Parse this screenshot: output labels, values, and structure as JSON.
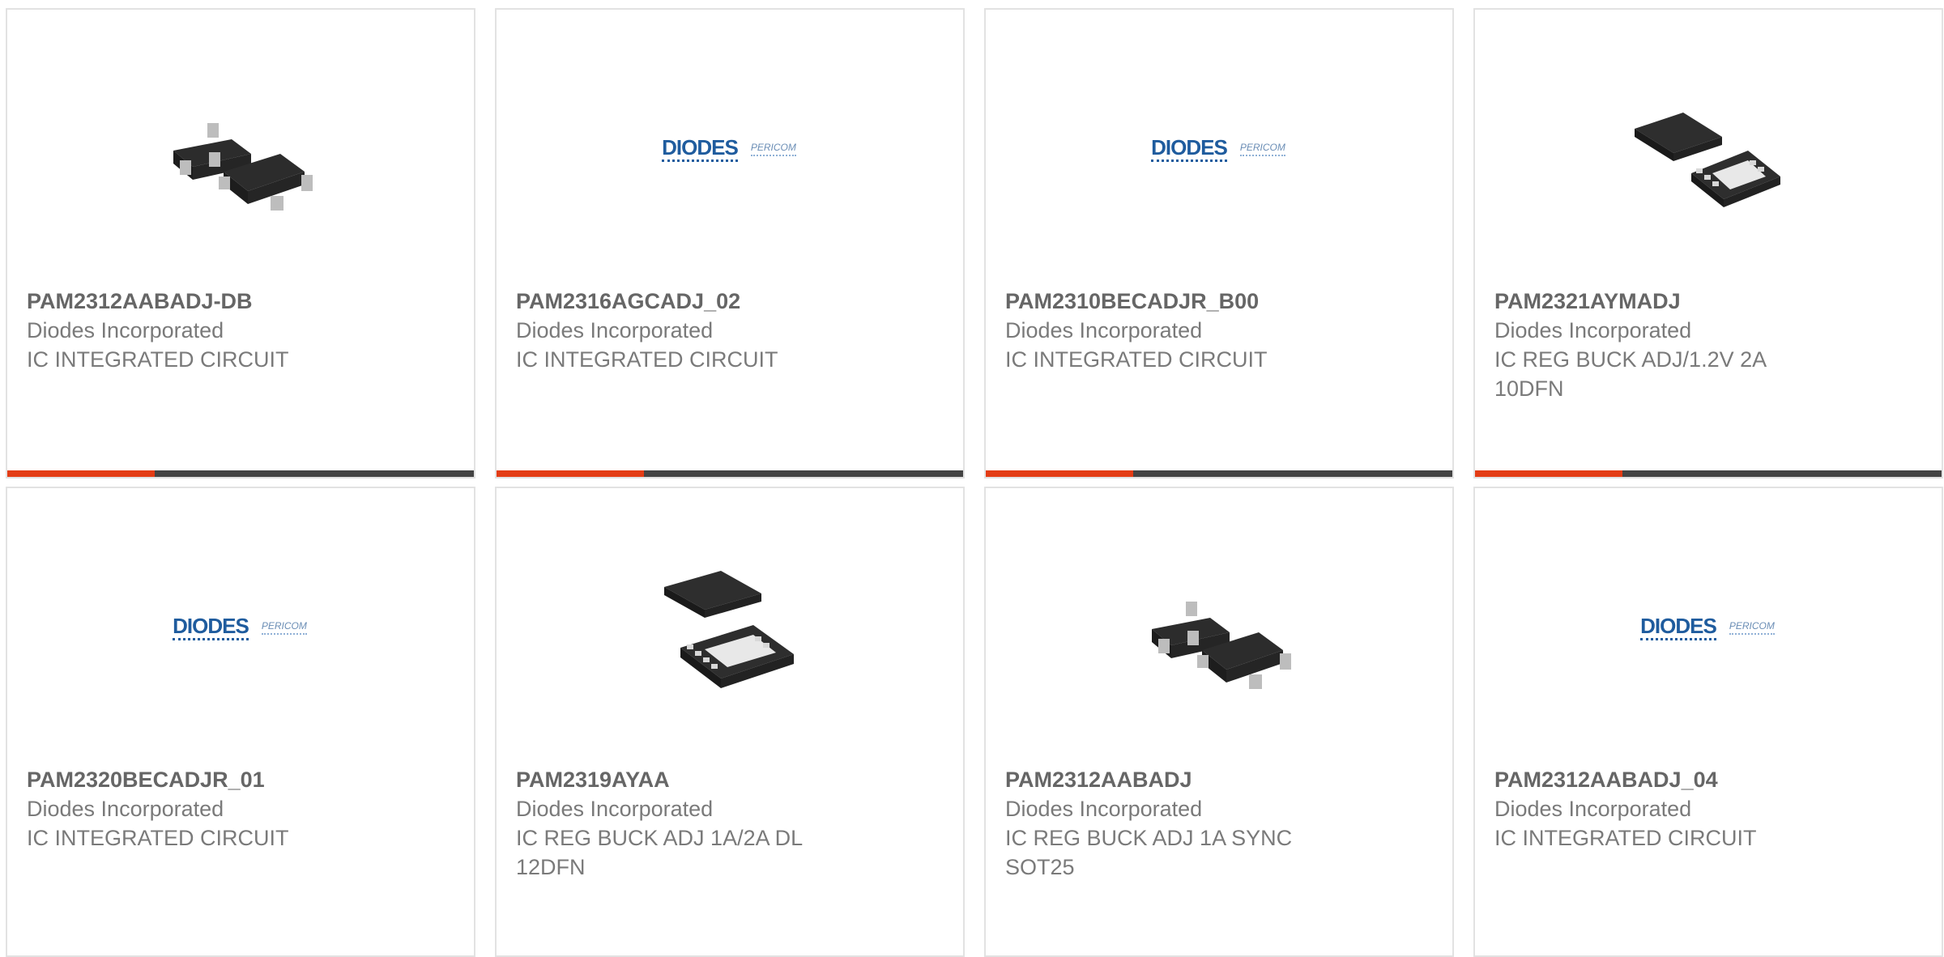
{
  "accent_color": "#e33c15",
  "bar_color": "#444444",
  "products": [
    {
      "part": "PAM2312AABADJ-DB",
      "manufacturer": "Diodes Incorporated",
      "description": "IC INTEGRATED CIRCUIT",
      "image": "sot25-package-icon"
    },
    {
      "part": "PAM2316AGCADJ_02",
      "manufacturer": "Diodes Incorporated",
      "description": "IC INTEGRATED CIRCUIT",
      "image": "diodes-pericom-logo"
    },
    {
      "part": "PAM2310BECADJR_B00",
      "manufacturer": "Diodes Incorporated",
      "description": "IC INTEGRATED CIRCUIT",
      "image": "diodes-pericom-logo"
    },
    {
      "part": "PAM2321AYMADJ",
      "manufacturer": "Diodes Incorporated",
      "description": "IC REG BUCK ADJ/1.2V 2A 10DFN",
      "image": "dfn10-package-icon"
    },
    {
      "part": "PAM2320BECADJR_01",
      "manufacturer": "Diodes Incorporated",
      "description": "IC INTEGRATED CIRCUIT",
      "image": "diodes-pericom-logo"
    },
    {
      "part": "PAM2319AYAA",
      "manufacturer": "Diodes Incorporated",
      "description": "IC REG BUCK ADJ 1A/2A DL 12DFN",
      "image": "dfn12-package-icon"
    },
    {
      "part": "PAM2312AABADJ",
      "manufacturer": "Diodes Incorporated",
      "description": "IC REG BUCK ADJ 1A SYNC SOT25",
      "image": "sot25-package-icon"
    },
    {
      "part": "PAM2312AABADJ_04",
      "manufacturer": "Diodes Incorporated",
      "description": "IC INTEGRATED CIRCUIT",
      "image": "diodes-pericom-logo"
    }
  ],
  "logo": {
    "brand": "DIODES",
    "sub": "PERICOM"
  }
}
